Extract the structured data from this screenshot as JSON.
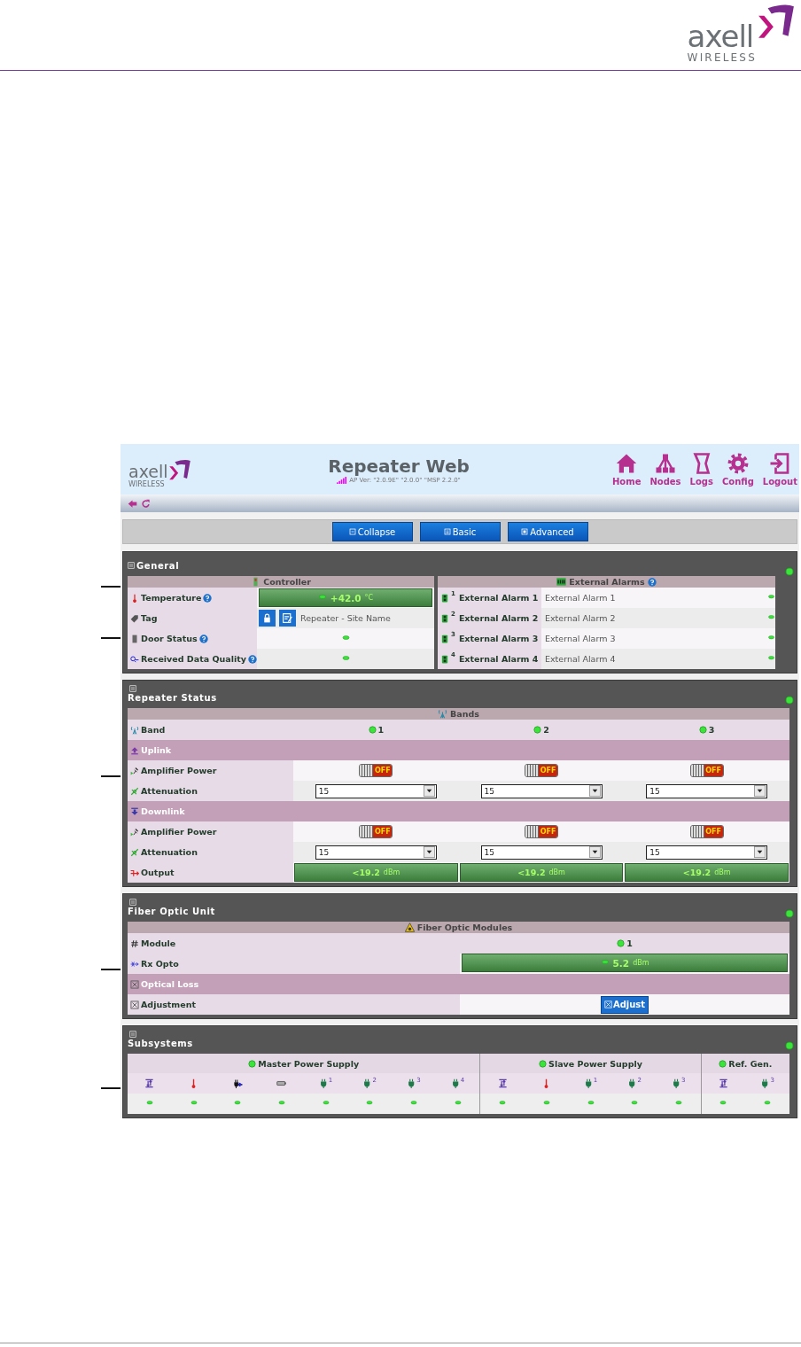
{
  "doc_header": {
    "logo_word": "axell",
    "logo_sub": "WIRELESS"
  },
  "app": {
    "logo_word": "axell",
    "logo_sub": "WIRELESS",
    "title": "Repeater Web",
    "version": "AP Ver: \"2.0.9E\" \"2.0.0\" \"MSP 2.2.0\"",
    "nav": [
      {
        "label": "Home"
      },
      {
        "label": "Nodes"
      },
      {
        "label": "Logs"
      },
      {
        "label": "Config"
      },
      {
        "label": "Logout"
      }
    ],
    "view_buttons": [
      {
        "label": "Collapse"
      },
      {
        "label": "Basic"
      },
      {
        "label": "Advanced"
      }
    ]
  },
  "panels": [
    {
      "kind": "general",
      "title": "General",
      "controller": {
        "title": "Controller",
        "rows": [
          {
            "label": "Temperature",
            "help": true,
            "kind": "meter",
            "value": "+42.0",
            "unit": "°C"
          },
          {
            "label": "Tag",
            "help": false,
            "kind": "tag",
            "value": "Repeater - Site Name"
          },
          {
            "label": "Door Status",
            "help": true,
            "kind": "led"
          },
          {
            "label": "Received Data Quality",
            "help": true,
            "kind": "led"
          }
        ]
      },
      "alarms": {
        "title": "External Alarms",
        "help": true,
        "rows": [
          {
            "num": "1",
            "label": "External Alarm 1",
            "value": "External Alarm 1"
          },
          {
            "num": "2",
            "label": "External Alarm 2",
            "value": "External Alarm 2"
          },
          {
            "num": "3",
            "label": "External Alarm 3",
            "value": "External Alarm 3"
          },
          {
            "num": "4",
            "label": "External Alarm 4",
            "value": "External Alarm 4"
          }
        ]
      }
    },
    {
      "kind": "bands",
      "title": "Repeater Status",
      "header": "Bands",
      "band_label": "Band",
      "bands": [
        "1",
        "2",
        "3"
      ],
      "sections": [
        {
          "title": "Uplink",
          "rows": [
            {
              "kind": "switch",
              "label": "Amplifier Power",
              "switches": [
                {
                  "on": false,
                  "text": "OFF"
                },
                {
                  "on": false,
                  "text": "OFF"
                },
                {
                  "on": false,
                  "text": "OFF"
                }
              ]
            },
            {
              "kind": "select",
              "label": "Attenuation",
              "values": [
                "15",
                "15",
                "15"
              ]
            }
          ]
        },
        {
          "title": "Downlink",
          "rows": [
            {
              "kind": "switch",
              "label": "Amplifier Power",
              "switches": [
                {
                  "on": false,
                  "text": "OFF"
                },
                {
                  "on": false,
                  "text": "OFF"
                },
                {
                  "on": false,
                  "text": "OFF"
                }
              ]
            },
            {
              "kind": "select",
              "label": "Attenuation",
              "values": [
                "15",
                "15",
                "15"
              ]
            }
          ]
        }
      ],
      "output": {
        "label": "Output",
        "values": [
          {
            "value": "<19.2",
            "unit": "dBm"
          },
          {
            "value": "<19.2",
            "unit": "dBm"
          },
          {
            "value": "<19.2",
            "unit": "dBm"
          }
        ]
      }
    },
    {
      "kind": "fiber",
      "title": "Fiber Optic Unit",
      "header": "Fiber Optic Modules",
      "module_label": "Module",
      "module": "1",
      "rx_label": "Rx Opto",
      "rx_value": "5.2",
      "rx_unit": "dBm",
      "section": "Optical Loss",
      "adjust_label": "Adjustment",
      "adjust_button": "Adjust"
    },
    {
      "kind": "subsystems",
      "title": "Subsystems",
      "groups": [
        {
          "title": "Master Power Supply",
          "items": [
            {
              "kind": "swap"
            },
            {
              "kind": "thermo"
            },
            {
              "kind": "plug-in"
            },
            {
              "kind": "battery"
            },
            {
              "kind": "plug",
              "sup": "1"
            },
            {
              "kind": "plug",
              "sup": "2"
            },
            {
              "kind": "plug",
              "sup": "3"
            },
            {
              "kind": "plug",
              "sup": "4"
            }
          ]
        },
        {
          "title": "Slave Power Supply",
          "items": [
            {
              "kind": "swap"
            },
            {
              "kind": "thermo"
            },
            {
              "kind": "plug",
              "sup": "1"
            },
            {
              "kind": "plug",
              "sup": "2"
            },
            {
              "kind": "plug",
              "sup": "3"
            }
          ]
        },
        {
          "title": "Ref. Gen.",
          "items": [
            {
              "kind": "swap"
            },
            {
              "kind": "plug",
              "sup": "3"
            }
          ]
        }
      ]
    }
  ]
}
